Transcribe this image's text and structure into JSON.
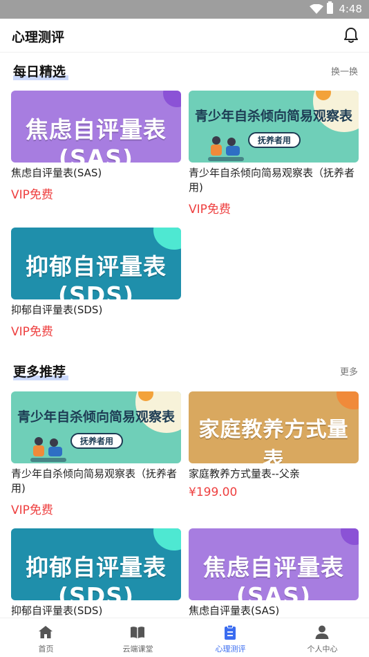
{
  "status": {
    "time": "4:48"
  },
  "header": {
    "title": "心理测评"
  },
  "daily": {
    "title": "每日精选",
    "action": "换一换",
    "items": [
      {
        "banner": "焦虑自评量表(SAS)",
        "name": "焦虑自评量表(SAS)",
        "price": "VIP免费"
      },
      {
        "banner": "青少年自杀倾向简易观察表",
        "tag": "抚养者用",
        "name": "青少年自杀倾向简易观察表（抚养者用)",
        "price": "VIP免费"
      },
      {
        "banner": "抑郁自评量表(SDS)",
        "name": "抑郁自评量表(SDS)",
        "price": "VIP免费"
      }
    ]
  },
  "more": {
    "title": "更多推荐",
    "action": "更多",
    "items": [
      {
        "banner": "青少年自杀倾向简易观察表",
        "tag": "抚养者用",
        "name": "青少年自杀倾向简易观察表（抚养者用)",
        "price": "VIP免费"
      },
      {
        "banner": "家庭教养方式量表",
        "name": "家庭教养方式量表--父亲",
        "price": "¥199.00"
      },
      {
        "banner": "抑郁自评量表(SDS)",
        "name": "抑郁自评量表(SDS)"
      },
      {
        "banner": "焦虑自评量表(SAS)",
        "name": "焦虑自评量表(SAS)"
      }
    ]
  },
  "tabs": [
    {
      "label": "首页",
      "icon": "home-icon"
    },
    {
      "label": "云端课堂",
      "icon": "book-icon"
    },
    {
      "label": "心理测评",
      "icon": "clipboard-icon",
      "active": true
    },
    {
      "label": "个人中心",
      "icon": "person-icon"
    }
  ],
  "colors": {
    "accent": "#3a6cf0",
    "price": "#ee3f3f",
    "sas": "#a77de0",
    "sds": "#1f8fab",
    "teen": "#6fcfb8",
    "family": "#d9a85f"
  }
}
